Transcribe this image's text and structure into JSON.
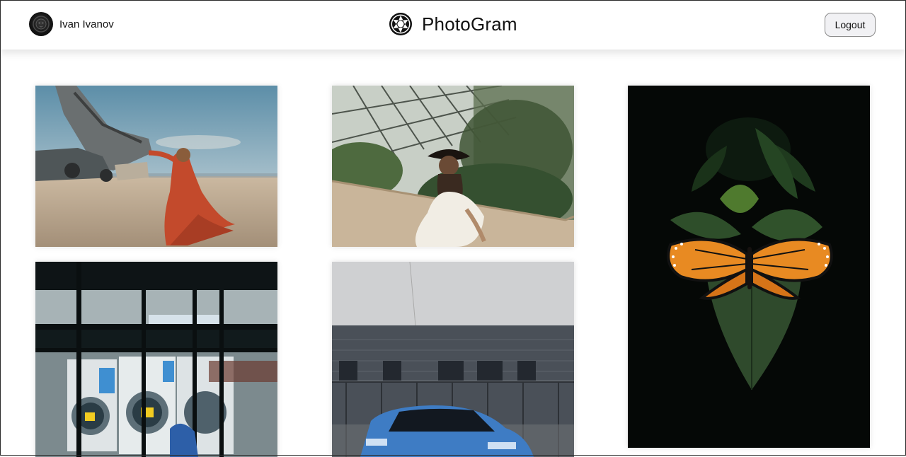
{
  "header": {
    "user_name": "Ivan Ivanov",
    "brand_name": "PhotoGram",
    "logout_label": "Logout",
    "avatar_icon": "avatar-lion-icon",
    "brand_icon": "camera-aperture-icon"
  },
  "gallery": {
    "photos": [
      {
        "subject": "woman-red-dress-beach-wreck"
      },
      {
        "subject": "woman-hat-greenhouse"
      },
      {
        "subject": "monarch-butterfly-on-leaf"
      },
      {
        "subject": "laundromat-washing-machines"
      },
      {
        "subject": "blue-car-parked-by-building"
      }
    ]
  },
  "colors": {
    "header_bg": "#ffffff",
    "button_bg": "#f1f1f4",
    "button_border": "#8a8a8a",
    "text": "#111111"
  }
}
